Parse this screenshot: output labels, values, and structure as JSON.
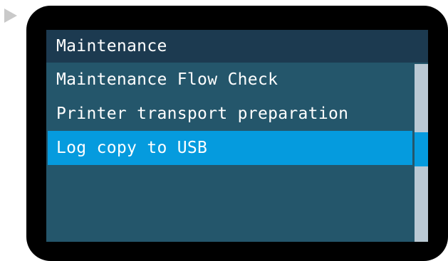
{
  "colors": {
    "bezel": "#000000",
    "screen_background": "#24566b",
    "header_background": "#1c3a50",
    "selection": "#059bde",
    "scroll_track": "#bac9d4",
    "text": "#ffffff"
  },
  "header": {
    "title": "Maintenance"
  },
  "menu": {
    "items": [
      {
        "label": "Maintenance Flow Check",
        "selected": false
      },
      {
        "label": "Printer transport preparation",
        "selected": false
      },
      {
        "label": "Log copy to USB",
        "selected": true
      }
    ]
  },
  "scrollbar": {
    "position_fraction": 0.4
  }
}
